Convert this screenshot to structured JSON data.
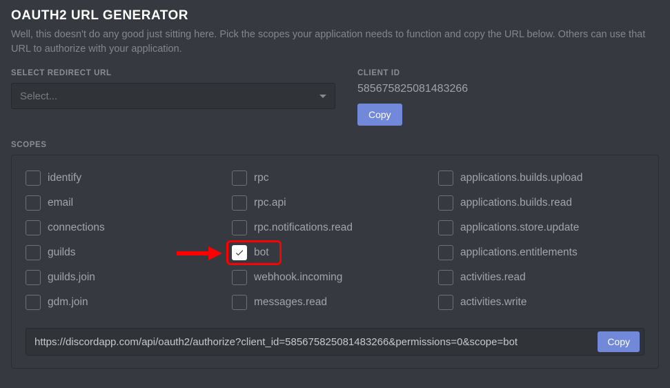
{
  "header": {
    "title": "OAUTH2 URL GENERATOR",
    "subtitle": "Well, this doesn't do any good just sitting here. Pick the scopes your application needs to function and copy the URL below. Others can use that URL to authorize with your application."
  },
  "redirect": {
    "label": "SELECT REDIRECT URL",
    "placeholder": "Select..."
  },
  "client": {
    "label": "CLIENT ID",
    "value": "585675825081483266",
    "copy_label": "Copy"
  },
  "scopes": {
    "label": "SCOPES",
    "col1": [
      {
        "label": "identify",
        "checked": false
      },
      {
        "label": "email",
        "checked": false
      },
      {
        "label": "connections",
        "checked": false
      },
      {
        "label": "guilds",
        "checked": false
      },
      {
        "label": "guilds.join",
        "checked": false
      },
      {
        "label": "gdm.join",
        "checked": false
      }
    ],
    "col2": [
      {
        "label": "rpc",
        "checked": false
      },
      {
        "label": "rpc.api",
        "checked": false
      },
      {
        "label": "rpc.notifications.read",
        "checked": false
      },
      {
        "label": "bot",
        "checked": true
      },
      {
        "label": "webhook.incoming",
        "checked": false
      },
      {
        "label": "messages.read",
        "checked": false
      }
    ],
    "col3": [
      {
        "label": "applications.builds.upload",
        "checked": false
      },
      {
        "label": "applications.builds.read",
        "checked": false
      },
      {
        "label": "applications.store.update",
        "checked": false
      },
      {
        "label": "applications.entitlements",
        "checked": false
      },
      {
        "label": "activities.read",
        "checked": false
      },
      {
        "label": "activities.write",
        "checked": false
      }
    ]
  },
  "url": {
    "value": "https://discordapp.com/api/oauth2/authorize?client_id=585675825081483266&permissions=0&scope=bot",
    "copy_label": "Copy"
  }
}
